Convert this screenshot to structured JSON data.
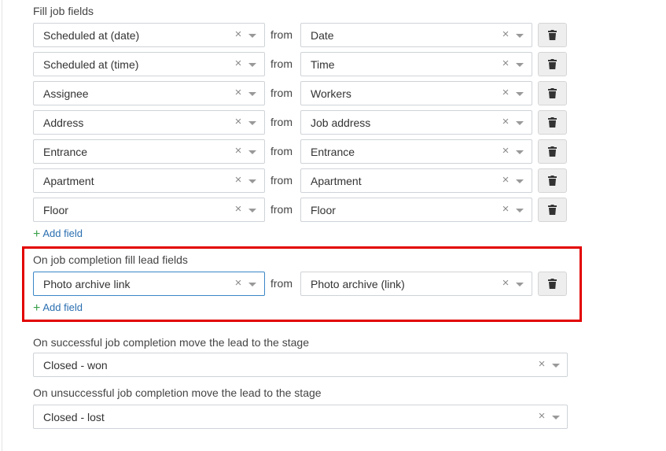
{
  "fill_job_fields": {
    "title": "Fill job fields",
    "from_label": "from",
    "rows": [
      {
        "field": "Scheduled at (date)",
        "source": "Date"
      },
      {
        "field": "Scheduled at (time)",
        "source": "Time"
      },
      {
        "field": "Assignee",
        "source": "Workers"
      },
      {
        "field": "Address",
        "source": "Job address"
      },
      {
        "field": "Entrance",
        "source": "Entrance"
      },
      {
        "field": "Apartment",
        "source": "Apartment"
      },
      {
        "field": "Floor",
        "source": "Floor"
      }
    ],
    "add_field_label": "Add field"
  },
  "completion_lead_fields": {
    "title": "On job completion fill lead fields",
    "from_label": "from",
    "rows": [
      {
        "field": "Photo archive link",
        "source": "Photo archive (link)"
      }
    ],
    "add_field_label": "Add field"
  },
  "success_stage": {
    "title": "On successful job completion move the lead to the stage",
    "value": "Closed - won"
  },
  "failure_stage": {
    "title": "On unsuccessful job completion move the lead to the stage",
    "value": "Closed - lost"
  },
  "icons": {
    "clear": "×",
    "delete": "trash-icon",
    "add": "+"
  },
  "colors": {
    "link": "#2a6fb0",
    "plus": "#3aa04a",
    "highlight": "#e30000",
    "focus_border": "#3b86c6"
  }
}
